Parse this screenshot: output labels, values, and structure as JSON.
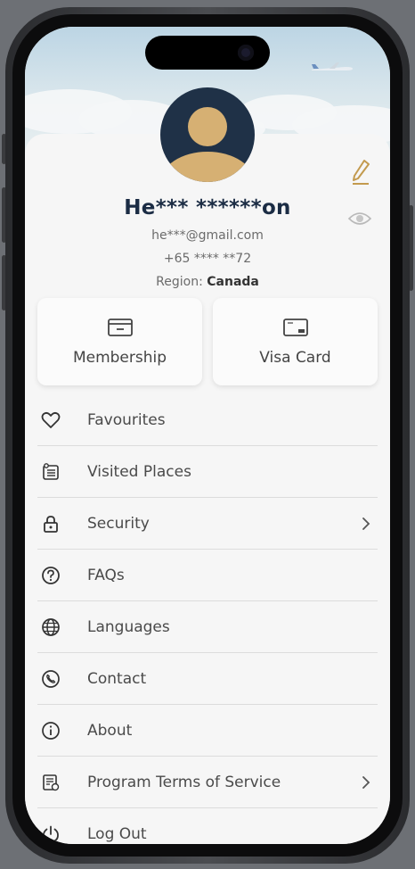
{
  "profile": {
    "name": "He*** ******on",
    "email": "he***@gmail.com",
    "phone": "+65 **** **72",
    "region_label": "Region:",
    "region_value": "Canada"
  },
  "tiles": [
    {
      "label": "Membership",
      "icon": "membership-card-icon"
    },
    {
      "label": "Visa Card",
      "icon": "visa-card-icon"
    }
  ],
  "menu": [
    {
      "label": "Favourites",
      "icon": "heart-icon",
      "chevron": false
    },
    {
      "label": "Visited Places",
      "icon": "visited-places-icon",
      "chevron": false
    },
    {
      "label": "Security",
      "icon": "lock-icon",
      "chevron": true
    },
    {
      "label": "FAQs",
      "icon": "question-icon",
      "chevron": false
    },
    {
      "label": "Languages",
      "icon": "globe-icon",
      "chevron": false
    },
    {
      "label": "Contact",
      "icon": "phone-icon",
      "chevron": false
    },
    {
      "label": "About",
      "icon": "info-icon",
      "chevron": false
    },
    {
      "label": "Program Terms of Service",
      "icon": "terms-document-icon",
      "chevron": true
    },
    {
      "label": "Log Out",
      "icon": "power-icon",
      "chevron": false
    }
  ],
  "colors": {
    "name": "#1b2c44",
    "avatar_bg": "#1f3147",
    "avatar_figure": "#d6b073",
    "edit_icon": "#c39a4e"
  }
}
